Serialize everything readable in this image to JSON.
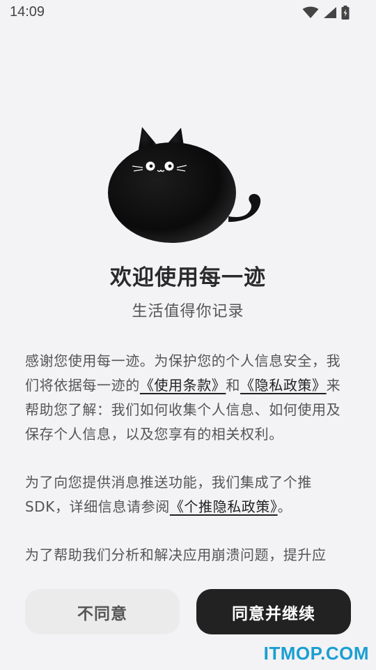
{
  "status": {
    "time": "14:09",
    "icons": [
      "wifi-icon",
      "cell-signal-icon",
      "battery-charging-icon"
    ]
  },
  "welcome": {
    "title": "欢迎使用每一迹",
    "subtitle": "生活值得你记录"
  },
  "agreement": {
    "p1_a": "感谢您使用每一迹。为保护您的个人信息安全，我们将依据每一迹的",
    "link_terms": "《使用条款》",
    "p1_b": "和",
    "link_privacy": "《隐私政策》",
    "p1_c": "来帮助您了解：我们如何收集个人信息、如何使用及保存个人信息，以及您享有的相关权利。",
    "p2_a": "为了向您提供消息推送功能，我们集成了个推SDK，详细信息请参阅",
    "link_getui": "《个推隐私政策》",
    "p2_b": "。",
    "p3": "为了帮助我们分析和解决应用崩溃问题，提升应"
  },
  "buttons": {
    "disagree": "不同意",
    "agree": "同意并继续"
  },
  "watermark": "ITMOP.COM",
  "colors": {
    "background": "#f3f2f5",
    "agree_button": "#222222",
    "disagree_button": "#ebebeb",
    "watermark": "#1a9fd1"
  }
}
